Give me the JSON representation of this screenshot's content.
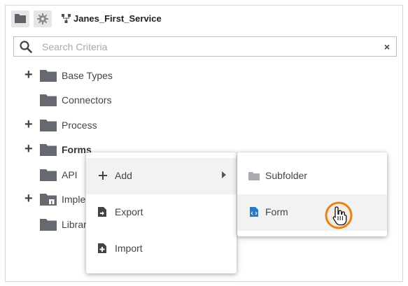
{
  "toolbar": {
    "folder_icon": "folder-icon",
    "gear_icon": "gear-icon",
    "service_icon": "service-icon",
    "title": "Janes_First_Service"
  },
  "search": {
    "placeholder": "Search Criteria",
    "value": "",
    "clear": "×"
  },
  "tree": {
    "items": [
      {
        "label": "Base Types",
        "expandable": true,
        "bold": false
      },
      {
        "label": "Connectors",
        "expandable": false,
        "bold": false
      },
      {
        "label": "Process",
        "expandable": true,
        "bold": false
      },
      {
        "label": "Forms",
        "expandable": true,
        "bold": true
      },
      {
        "label": "API",
        "expandable": false,
        "bold": false
      },
      {
        "label": "Imple",
        "expandable": true,
        "bold": false
      },
      {
        "label": "Librar",
        "expandable": false,
        "bold": false
      }
    ],
    "expand_symbol": "+"
  },
  "context_menu": {
    "items": [
      {
        "label": "Add",
        "icon": "plus-icon",
        "has_submenu": true
      },
      {
        "label": "Export",
        "icon": "export-file-icon"
      },
      {
        "label": "Import",
        "icon": "import-file-icon"
      }
    ]
  },
  "submenu": {
    "items": [
      {
        "label": "Subfolder",
        "icon": "folder-icon"
      },
      {
        "label": "Form",
        "icon": "form-file-icon"
      }
    ]
  },
  "colors": {
    "folder": "#666a70",
    "form_icon": "#2b78c7",
    "cursor_ring": "#e8801c",
    "hover_bg": "#f2f2f2"
  }
}
